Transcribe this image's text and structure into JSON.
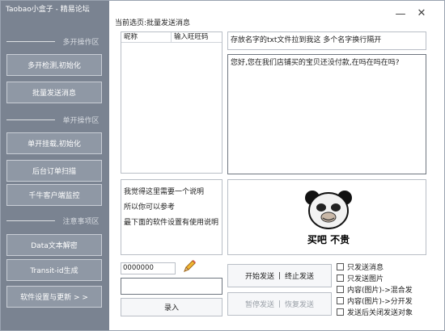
{
  "window": {
    "title": "Taobao小盒子 - 精易论坛",
    "breadcrumb": "当前选页:批量发送消息",
    "minimize_glyph": "—",
    "close_glyph": "✕"
  },
  "sidebar": {
    "sections": [
      {
        "label": "多开操作区"
      },
      {
        "label": "单开操作区"
      },
      {
        "label": "注意事项区"
      }
    ],
    "buttons": [
      {
        "label": "多开检测,初始化"
      },
      {
        "label": "批量发送消息"
      },
      {
        "label": "单开挂载,初始化"
      },
      {
        "label": "后台订单扫描"
      },
      {
        "label": "千牛客户端监控"
      },
      {
        "label": "Data文本解密"
      },
      {
        "label": "Transit-id生成"
      },
      {
        "label": "软件设置与更新 > >"
      }
    ]
  },
  "contact_list": {
    "columns": [
      "昵称",
      "输入旺旺码"
    ]
  },
  "notes": {
    "lines": [
      "我觉得这里需要一个说明",
      "所以你可以参考",
      "最下面的软件设置有使用说明"
    ]
  },
  "id_field": {
    "value": "0000000",
    "icon": "pencil-icon"
  },
  "record_button": {
    "label": "录入"
  },
  "file_hint": {
    "text": "存放名字的txt文件拉到我这 多个名字换行隔开"
  },
  "message": {
    "text": "您好,您在我们店铺买的宝贝还没付款,在吗在吗在吗?"
  },
  "image_preview": {
    "caption": "买吧 不贵"
  },
  "send_controls": {
    "start": "开始发送",
    "stop": "终止发送",
    "pause": "暂停发送",
    "resume": "恢复发送",
    "separator": "|"
  },
  "options": [
    {
      "label": "只发送消息",
      "checked": false
    },
    {
      "label": "只发送图片",
      "checked": false
    },
    {
      "label": "内容(图片)->混合发",
      "checked": false
    },
    {
      "label": "内容(图片)->分开发",
      "checked": false
    },
    {
      "label": "发送后关闭发送对象",
      "checked": false
    }
  ],
  "colors": {
    "sidebar": "#7a8391",
    "sidebar_button": "#8f98a5"
  }
}
